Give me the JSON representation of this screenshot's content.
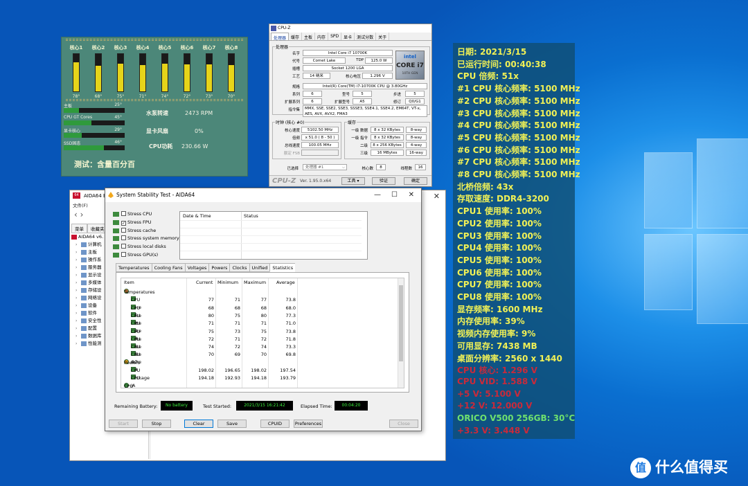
{
  "therm": {
    "cores": [
      {
        "label": "核心1",
        "temp": "78°",
        "level": 0.78
      },
      {
        "label": "核心2",
        "temp": "68°",
        "level": 0.68
      },
      {
        "label": "核心3",
        "temp": "75°",
        "level": 0.75
      },
      {
        "label": "核心4",
        "temp": "71°",
        "level": 0.71
      },
      {
        "label": "核心5",
        "temp": "74°",
        "level": 0.74
      },
      {
        "label": "核心6",
        "temp": "72°",
        "level": 0.72
      },
      {
        "label": "核心7",
        "temp": "73°",
        "level": 0.73
      },
      {
        "label": "核心8",
        "temp": "70°",
        "level": 0.7
      }
    ],
    "rows": [
      {
        "name": "主板",
        "value": "25°",
        "level": 0.25
      },
      {
        "name": "CPU GT Cores",
        "value": "45°",
        "level": 0.45
      },
      {
        "name": "显卡核心",
        "value": "29°",
        "level": 0.29
      },
      {
        "name": "SSD固态",
        "value": "46°",
        "level": 0.66
      }
    ],
    "pump_label": "水泵转速",
    "pump_value": "2473 RPM",
    "fan_label": "显卡风扇",
    "fan_value": "0%",
    "power_label": "CPU功耗",
    "power_value": "230.66 W",
    "note": "测试：含量百分百"
  },
  "cpuz": {
    "title": "CPU-Z",
    "tabs": [
      "处理器",
      "缓存",
      "主板",
      "内存",
      "SPD",
      "显卡",
      "测试分数",
      "关于"
    ],
    "group_processor": "处理器",
    "name_k": "名字",
    "name_v": "Intel Core i7 10700K",
    "code_k": "代号",
    "code_v": "Comet Lake",
    "tdp_k": "TDP",
    "tdp_v": "125.0 W",
    "socket_k": "插槽",
    "socket_v": "Socket 1200 LGA",
    "tech_k": "工艺",
    "tech_v": "14 纳米",
    "volt_k": "核心电压",
    "volt_v": "1.296 V",
    "spec_k": "规格",
    "spec_v": "Intel(R) Core(TM) i7-10700K CPU @ 3.80GHz",
    "family_k": "系列",
    "family_v": "6",
    "model_k": "型号",
    "model_v": "5",
    "step_k": "步进",
    "step_v": "5",
    "extfam_k": "扩展系列",
    "extfam_v": "6",
    "extmod_k": "扩展型号",
    "extmod_v": "A5",
    "rev_k": "修订",
    "rev_v": "Q0/G1",
    "inst_k": "指令集",
    "inst_v1": "MMX, SSE, SSE2, SSE3, SSSE3, SSE4.1, SSE4.2, EM64T, VT-x,",
    "inst_v2": "AES, AVX, AVX2, FMA3",
    "group_clock": "时钟 (核心 #0)",
    "cs_k": "核心速度",
    "cs_v": "5102.50 MHz",
    "mul_k": "倍频",
    "mul_v": "x 51.0 ( 8 - 50 )",
    "bus_k": "总线速度",
    "bus_v": "100.05 MHz",
    "fsb_k": "额定 FSB",
    "fsb_v": "",
    "group_cache": "缓存",
    "l1d_k": "一级 数据",
    "l1d_v": "8 x 32 KBytes",
    "l1d_w": "8-way",
    "l1i_k": "一级 指令",
    "l1i_v": "8 x 32 KBytes",
    "l1i_w": "8-way",
    "l2_k": "二级",
    "l2_v": "8 x 256 KBytes",
    "l2_w": "4-way",
    "l3_k": "三级",
    "l3_v": "16 MBytes",
    "l3_w": "16-way",
    "sel_k": "已选择",
    "sel_v": "处理器 #1",
    "cores_k": "核心数",
    "cores_v": "8",
    "threads_k": "线程数",
    "threads_v": "16",
    "logo_brand": "intel",
    "logo_model": "CORE i7",
    "logo_gen": "10TH GEN",
    "brand": "CPU-Z",
    "version": "Ver. 1.95.0.x64",
    "tools": "工具",
    "validate": "验证",
    "ok": "确定"
  },
  "osd": {
    "lines": [
      {
        "text": "日期: 2021/3/15",
        "style": "y"
      },
      {
        "text": "已运行时间: 00:40:38",
        "style": "y"
      },
      {
        "text": "CPU 倍频: 51x",
        "style": "y"
      },
      {
        "text": "#1 CPU 核心频率: 5100 MHz",
        "style": "y"
      },
      {
        "text": "#2 CPU 核心频率: 5100 MHz",
        "style": "y"
      },
      {
        "text": "#3 CPU 核心频率: 5100 MHz",
        "style": "y"
      },
      {
        "text": "#4 CPU 核心频率: 5100 MHz",
        "style": "y"
      },
      {
        "text": "#5 CPU 核心频率: 5100 MHz",
        "style": "y"
      },
      {
        "text": "#6 CPU 核心频率: 5100 MHz",
        "style": "y"
      },
      {
        "text": "#7 CPU 核心频率: 5100 MHz",
        "style": "y"
      },
      {
        "text": "#8 CPU 核心频率: 5100 MHz",
        "style": "y"
      },
      {
        "text": "北桥倍频: 43x",
        "style": "y"
      },
      {
        "text": "存取速度: DDR4-3200",
        "style": "y"
      },
      {
        "text": "CPU1 使用率: 100%",
        "style": "y"
      },
      {
        "text": "CPU2 使用率: 100%",
        "style": "y"
      },
      {
        "text": "CPU3 使用率: 100%",
        "style": "y"
      },
      {
        "text": "CPU4 使用率: 100%",
        "style": "y"
      },
      {
        "text": "CPU5 使用率: 100%",
        "style": "y"
      },
      {
        "text": "CPU6 使用率: 100%",
        "style": "y"
      },
      {
        "text": "CPU7 使用率: 100%",
        "style": "y"
      },
      {
        "text": "CPU8 使用率: 100%",
        "style": "y"
      },
      {
        "text": "显存频率: 1600 MHz",
        "style": "y"
      },
      {
        "text": "内存使用率: 39%",
        "style": "y"
      },
      {
        "text": "视频内存使用率: 9%",
        "style": "y"
      },
      {
        "text": "可用显存: 7438 MB",
        "style": "y"
      },
      {
        "text": "桌面分辨率: 2560 x 1440",
        "style": "y"
      },
      {
        "text": "CPU 核心: 1.296 V",
        "style": "r"
      },
      {
        "text": "CPU VID: 1.588 V",
        "style": "r"
      },
      {
        "text": "+5 V: 5.100 V",
        "style": "r"
      },
      {
        "text": "+12 V: 12.000 V",
        "style": "r"
      },
      {
        "text": "ORICO V500 256GB: 30°C",
        "style": "g"
      },
      {
        "text": "+3.3 V: 3.448 V",
        "style": "r"
      }
    ]
  },
  "aida": {
    "title": "AIDA64 E",
    "menu": "文件(F)",
    "tab_menu": "菜单",
    "tab_fav": "收藏夹",
    "root": "AIDA64 v6.",
    "tree": [
      "计算机",
      "主板",
      "操作系",
      "服务器",
      "显示设",
      "多媒体",
      "存储设",
      "网络设",
      "设备",
      "软件",
      "安全性",
      "配置",
      "数据库",
      "性能测"
    ]
  },
  "sst": {
    "title": "System Stability Test - AIDA64",
    "checks": [
      {
        "label": "Stress CPU",
        "checked": false
      },
      {
        "label": "Stress FPU",
        "checked": true
      },
      {
        "label": "Stress cache",
        "checked": false
      },
      {
        "label": "Stress system memory",
        "checked": false
      },
      {
        "label": "Stress local disks",
        "checked": false
      },
      {
        "label": "Stress GPU(s)",
        "checked": false
      }
    ],
    "log_date": "Date & Time",
    "log_status": "Status",
    "tabs": [
      "Temperatures",
      "Cooling Fans",
      "Voltages",
      "Powers",
      "Clocks",
      "Unified",
      "Statistics"
    ],
    "cols": {
      "item": "Item",
      "current": "Current",
      "minimum": "Minimum",
      "maximum": "Maximum",
      "average": "Average"
    },
    "group_temp": "Temperatures",
    "rows": [
      {
        "name": "CPU Core #1",
        "cur": "77",
        "min": "71",
        "max": "77",
        "avg": "73.8"
      },
      {
        "name": "CPU Core #2",
        "cur": "68",
        "min": "68",
        "max": "68",
        "avg": "68.0"
      },
      {
        "name": "CPU Core #3",
        "cur": "80",
        "min": "75",
        "max": "80",
        "avg": "77.3"
      },
      {
        "name": "CPU Core #4",
        "cur": "71",
        "min": "71",
        "max": "71",
        "avg": "71.0"
      },
      {
        "name": "CPU Core #5",
        "cur": "75",
        "min": "73",
        "max": "75",
        "avg": "73.8"
      },
      {
        "name": "CPU Core #6",
        "cur": "72",
        "min": "71",
        "max": "72",
        "avg": "71.8"
      },
      {
        "name": "CPU Core #7",
        "cur": "74",
        "min": "72",
        "max": "74",
        "avg": "73.3"
      },
      {
        "name": "CPU Core #8",
        "cur": "70",
        "min": "69",
        "max": "70",
        "avg": "69.8"
      }
    ],
    "group_power": "Powers",
    "prows": [
      {
        "name": "CPU Package",
        "cur": "198.02",
        "min": "196.65",
        "max": "198.02",
        "avg": "197.54"
      },
      {
        "name": "CPU IA Cores",
        "cur": "194.18",
        "min": "192.93",
        "max": "194.18",
        "avg": "193.79"
      }
    ],
    "group_cpu": "CPU",
    "rb_label": "Remaining Battery:",
    "rb_value": "No battery",
    "ts_label": "Test Started:",
    "ts_value": "2021/3/15 16:21:42",
    "et_label": "Elapsed Time:",
    "et_value": "00:04:20",
    "btn_start": "Start",
    "btn_stop": "Stop",
    "btn_clear": "Clear",
    "btn_save": "Save",
    "btn_cpuid": "CPUID",
    "btn_pref": "Preferences",
    "btn_close": "Close"
  },
  "watermark": {
    "icon": "值",
    "text": "什么值得买"
  }
}
